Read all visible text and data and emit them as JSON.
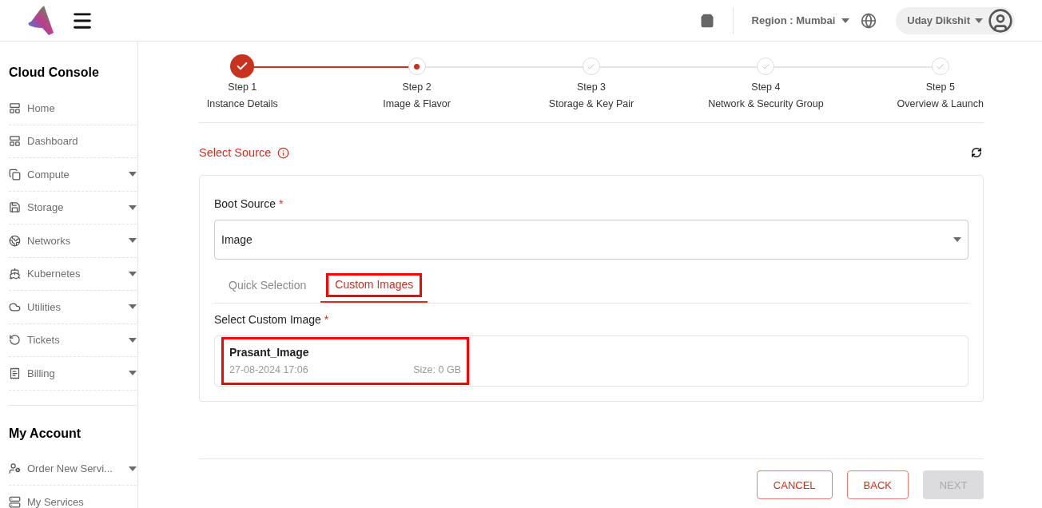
{
  "header": {
    "region_label": "Region : Mumbai",
    "user_name": "Uday Dikshit"
  },
  "sidebar": {
    "sections": [
      {
        "title": "Cloud Console",
        "items": [
          {
            "label": "Home",
            "kind": "link"
          },
          {
            "label": "Dashboard",
            "kind": "link"
          },
          {
            "label": "Compute",
            "kind": "menu"
          },
          {
            "label": "Storage",
            "kind": "menu"
          },
          {
            "label": "Networks",
            "kind": "menu"
          },
          {
            "label": "Kubernetes",
            "kind": "menu"
          },
          {
            "label": "Utilities",
            "kind": "menu"
          },
          {
            "label": "Tickets",
            "kind": "menu"
          },
          {
            "label": "Billing",
            "kind": "menu"
          }
        ]
      },
      {
        "title": "My Account",
        "items": [
          {
            "label": "Order New Servi...",
            "kind": "menu"
          },
          {
            "label": "My Services",
            "kind": "link"
          }
        ]
      }
    ]
  },
  "stepper": [
    {
      "step": "Step 1",
      "label": "Instance Details",
      "completed": true,
      "active": false
    },
    {
      "step": "Step 2",
      "label": "Image & Flavor",
      "completed": false,
      "active": true
    },
    {
      "step": "Step 3",
      "label": "Storage & Key Pair",
      "completed": false,
      "active": false
    },
    {
      "step": "Step 4",
      "label": "Network & Security Group",
      "completed": false,
      "active": false
    },
    {
      "step": "Step 5",
      "label": "Overview & Launch",
      "completed": false,
      "active": false
    }
  ],
  "section_title": "Select Source",
  "boot_source": {
    "label": "Boot Source",
    "required": "*",
    "value": "Image"
  },
  "tabs": [
    {
      "label": "Quick Selection",
      "selected": false,
      "highlighted": false
    },
    {
      "label": "Custom Images",
      "selected": true,
      "highlighted": true
    }
  ],
  "custom_image": {
    "label": "Select Custom Image",
    "required": "*",
    "items": [
      {
        "name": "Prasant_Image",
        "date": "27-08-2024 17:06",
        "size": "Size: 0 GB",
        "highlighted": true
      }
    ]
  },
  "buttons": [
    {
      "label": "CANCEL",
      "disabled": false
    },
    {
      "label": "BACK",
      "disabled": false
    },
    {
      "label": "NEXT",
      "disabled": true
    }
  ]
}
